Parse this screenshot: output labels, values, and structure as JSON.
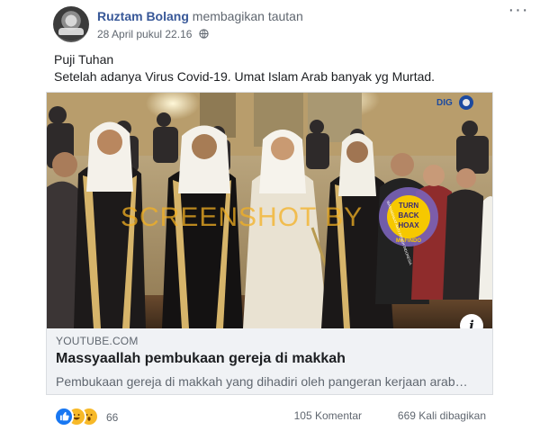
{
  "header": {
    "author_name": "Ruztam Bolang",
    "action_text": "membagikan tautan",
    "timestamp": "28 April pukul 22.16",
    "more_label": "···"
  },
  "post_text": {
    "line1": "Puji Tuhan",
    "line2": "Setelah adanya Virus Covid-19. Umat Islam Arab banyak yg Murtad."
  },
  "link_card": {
    "domain": "YOUTUBE.COM",
    "title": "Massyaallah pembukaan gereja di makkah",
    "description": "Pembukaan gereja di makkah yang dihadiri oleh pangeran kerjaan arab…",
    "info_label": "i",
    "watermark": "SCREENSHOT BY",
    "badge": {
      "line1": "TURN",
      "line2": "BACK",
      "line3": "HOAX",
      "outer_text": "MASYARAKAT ANTI FITNAH INDONESIA",
      "bottom_text": "MAFINDO"
    },
    "channel_logo": "DIG"
  },
  "footer": {
    "reactions": [
      "like-icon",
      "haha-icon",
      "wow-icon"
    ],
    "reaction_count": "66",
    "comments": "105 Komentar",
    "shares": "669 Kali dibagikan"
  },
  "colors": {
    "author": "#385898",
    "muted": "#606770",
    "card_bg": "#f0f2f5",
    "like": "#1877f2",
    "emoji": "#f7b928"
  }
}
